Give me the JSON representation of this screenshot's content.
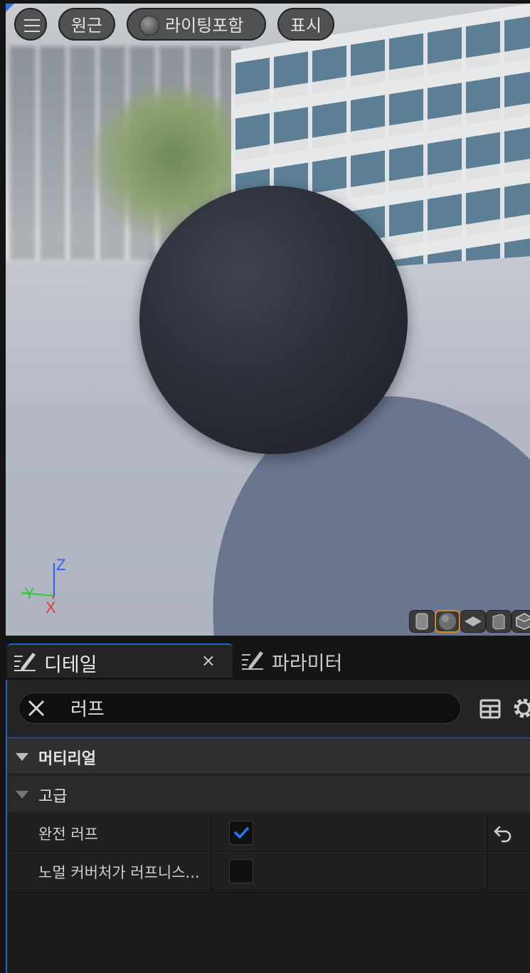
{
  "viewport": {
    "toolbar": {
      "menu_icon": "hamburger-icon",
      "perspective_label": "원근",
      "lit_label": "라이팅포함",
      "show_label": "표시"
    },
    "axis": {
      "z": "Z",
      "y": "Y",
      "x": "X"
    },
    "preview_shapes": [
      "cylinder-icon",
      "sphere-icon",
      "plane-icon",
      "cube-icon",
      "custom-mesh-icon"
    ],
    "active_shape": "sphere-icon"
  },
  "tabs": {
    "details_label": "디테일",
    "details_close": "×",
    "params_label": "파라미터"
  },
  "search": {
    "value": "러프"
  },
  "categories": {
    "material": "머티리얼",
    "advanced": "고급"
  },
  "properties": [
    {
      "name": "완전 러프",
      "checked": true,
      "reset": true
    },
    {
      "name": "노멀 커버처가 러프니스...",
      "checked": false,
      "reset": false
    }
  ],
  "colors": {
    "accent": "#2a63c4",
    "checkmark": "#1e7bff",
    "active_shape_border": "#d38a28"
  }
}
